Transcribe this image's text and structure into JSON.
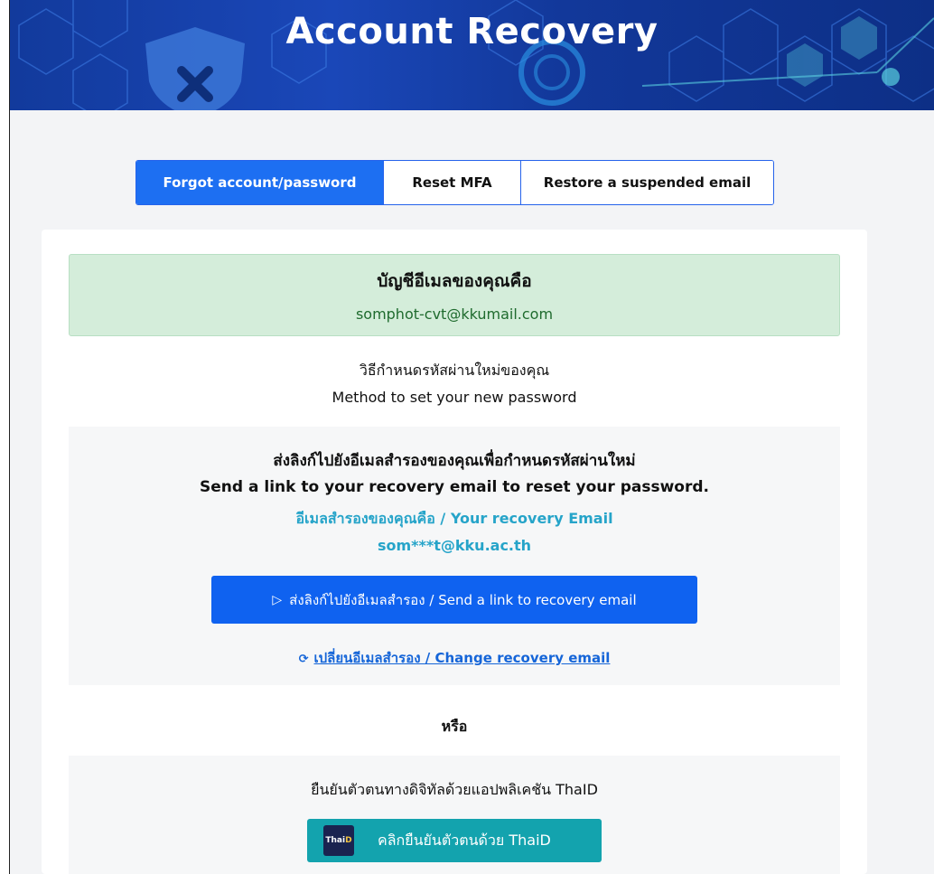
{
  "banner": {
    "title": "Account Recovery"
  },
  "tabs": [
    {
      "label": "Forgot account/password",
      "active": true
    },
    {
      "label": "Reset MFA",
      "active": false
    },
    {
      "label": "Restore a suspended email",
      "active": false
    }
  ],
  "account": {
    "title": "บัญชีอีเมลของคุณคือ",
    "email": "somphot-cvt@kkumail.com"
  },
  "method": {
    "title_th": "วิธีกำหนดรหัสผ่านใหม่ของคุณ",
    "title_en": "Method to set your new password"
  },
  "recovery": {
    "heading_th": "ส่งลิงก์ไปยังอีเมลสำรองของคุณเพื่อกำหนดรหัสผ่านใหม่",
    "heading_en": "Send a link to your recovery email to reset your password.",
    "label": "อีเมลสำรองของคุณคือ / Your recovery Email",
    "email": "som***t@kku.ac.th",
    "send_button": "ส่งลิงก์ไปยังอีเมลสำรอง / Send a link to recovery email",
    "change_link": "เปลี่ยนอีเมลสำรอง / Change recovery email"
  },
  "or_text": "หรือ",
  "thaid": {
    "description": "ยืนยันตัวตนทางดิจิทัลด้วยแอปพลิเคชัน ThaID",
    "button": "คลิกยืนยันตัวตนด้วย ThaiD",
    "logo_thai": "Thai",
    "logo_id": "D"
  },
  "colors": {
    "primary": "#1d6ff2",
    "success_bg": "#d4edda",
    "success_text": "#1f6b2e",
    "teal": "#26a4c9",
    "thaid_button": "#13a3ae"
  }
}
